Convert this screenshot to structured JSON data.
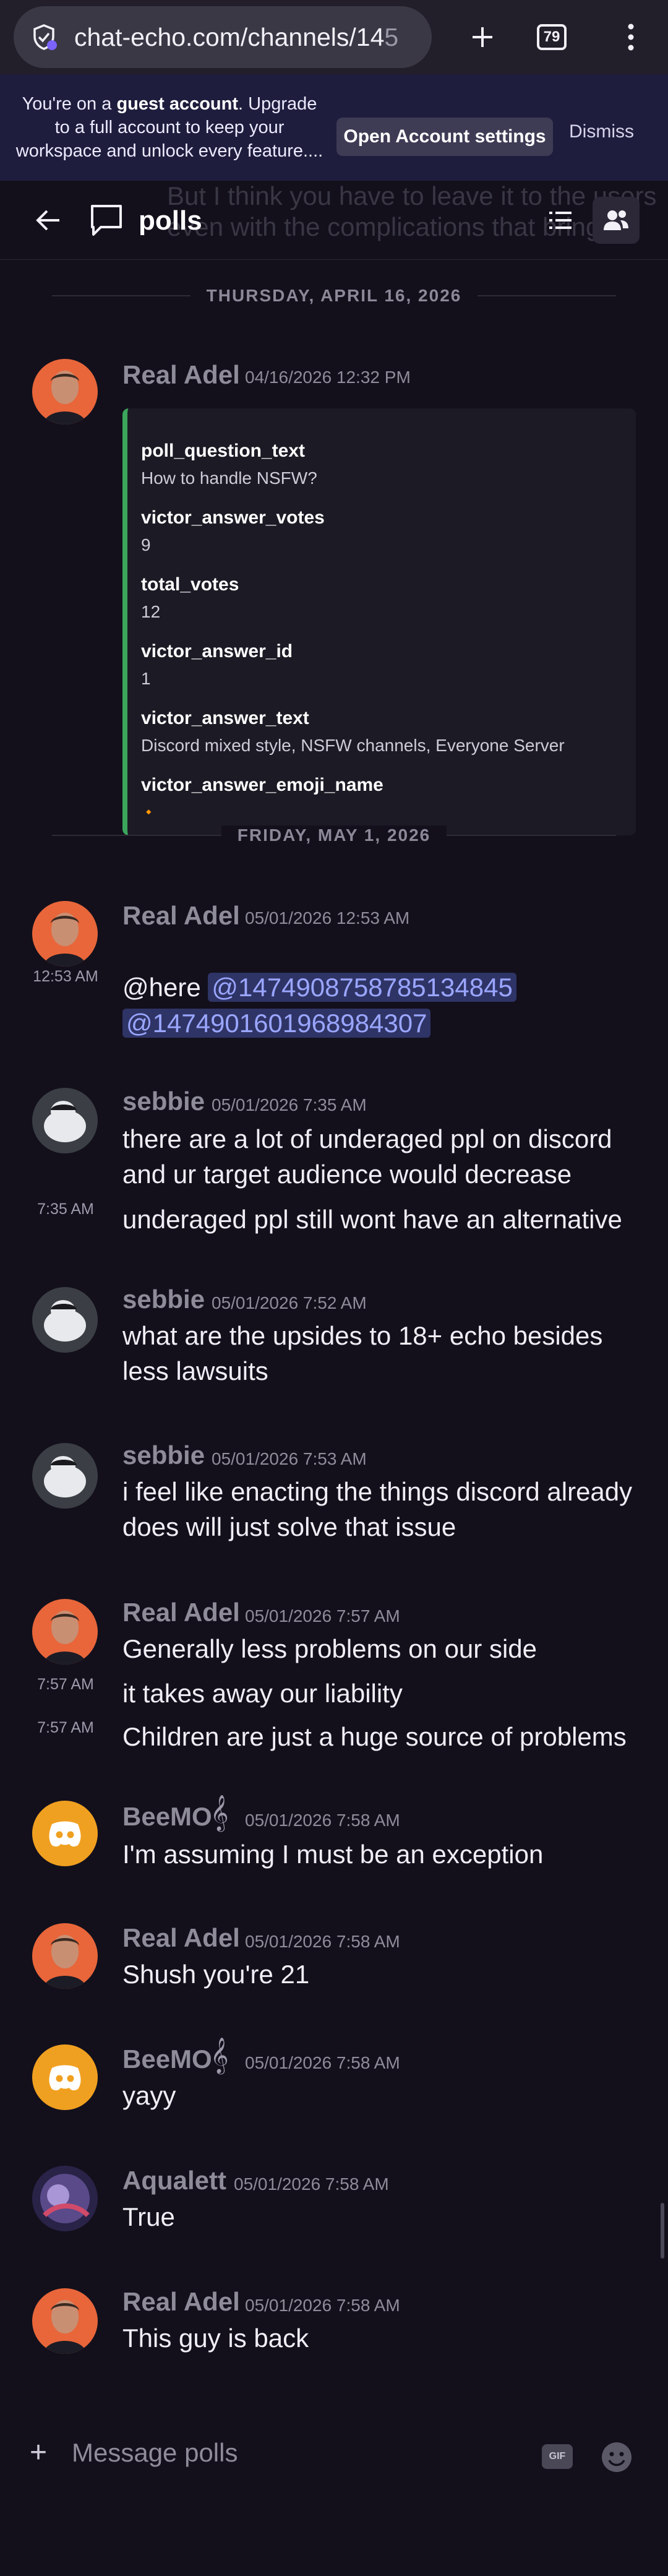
{
  "browser": {
    "url_main": "chat-echo.com/channels/14",
    "url_faded": "5",
    "tab_count": "79"
  },
  "banner": {
    "text_before": "You're on a ",
    "text_bold": "guest account",
    "text_after": ". Upgrade to a full account to keep your workspace and unlock every feature....",
    "open_settings_label": "Open Account settings",
    "dismiss_label": "Dismiss"
  },
  "channel": {
    "name": "polls",
    "behind_text_1": "But I think you have to leave it to the users",
    "behind_text_2": "even with the complications that brings"
  },
  "dividers": {
    "d1": "THURSDAY, APRIL 16, 2026",
    "d2": "FRIDAY, MAY 1, 2026"
  },
  "poll": {
    "author": "Real Adel",
    "timestamp": "04/16/2026 12:32 PM",
    "fields": {
      "f1_name": "poll_question_text",
      "f1_value": "How to handle NSFW?",
      "f2_name": "victor_answer_votes",
      "f2_value": "9",
      "f3_name": "total_votes",
      "f3_value": "12",
      "f4_name": "victor_answer_id",
      "f4_value": "1",
      "f5_name": "victor_answer_text",
      "f5_value": "Discord mixed style, NSFW channels, Everyone Server",
      "f6_name": "victor_answer_emoji_name",
      "f6_value": "🔸"
    }
  },
  "messages": {
    "m1": {
      "author": "Real Adel",
      "timestamp": "05/01/2026 12:53 AM",
      "side_time": "12:53 AM",
      "here": "@here",
      "mention1": "@1474908758785134845",
      "mention2": "@1474901601968984307"
    },
    "m2": {
      "author": "sebbie",
      "timestamp": "05/01/2026 7:35 AM",
      "text1": "there are a lot of underaged ppl on discord and ur target audience would decrease",
      "side_time": "7:35 AM",
      "text2": "underaged ppl still wont have an alternative"
    },
    "m3": {
      "author": "sebbie",
      "timestamp": "05/01/2026 7:52 AM",
      "text1": "what are the upsides to 18+ echo besides less lawsuits"
    },
    "m4": {
      "author": "sebbie",
      "timestamp": "05/01/2026 7:53 AM",
      "text1": "i feel like enacting the things discord already does will just solve that issue"
    },
    "m5": {
      "author": "Real Adel",
      "timestamp": "05/01/2026 7:57 AM",
      "text1": "Generally less problems on our side",
      "side_time1": "7:57 AM",
      "text2": "it takes away our liability",
      "side_time2": "7:57 AM",
      "text3": "Children are just a huge source of problems"
    },
    "m6": {
      "author": "BeeMO",
      "timestamp": "05/01/2026 7:58 AM",
      "text1": "I'm assuming I must be an exception"
    },
    "m7": {
      "author": "Real Adel",
      "timestamp": "05/01/2026 7:58 AM",
      "text1": "Shush you're 21"
    },
    "m8": {
      "author": "BeeMO",
      "timestamp": "05/01/2026 7:58 AM",
      "text1": "yayy"
    },
    "m9": {
      "author": "Aqualett",
      "timestamp": "05/01/2026 7:58 AM",
      "text1": "True"
    },
    "m10": {
      "author": "Real Adel",
      "timestamp": "05/01/2026 7:58 AM",
      "text1": "This guy is back"
    }
  },
  "input": {
    "placeholder": "Message polls",
    "gif_label": "GIF"
  },
  "colors": {
    "background": "#13101c",
    "embed_accent": "#3ba55c",
    "mention_bg": "#2f3466",
    "bot_avatar": "#f0a020"
  },
  "icons": {
    "site_info": "shield-check-icon",
    "new_tab": "plus-icon",
    "browser_menu": "vertical-dots-icon",
    "back": "arrow-left-icon",
    "channel": "speech-bubble-icon",
    "threads": "list-icon",
    "members": "people-icon",
    "bot_badge": "treble-clef-icon",
    "emoji": "smiley-icon"
  }
}
